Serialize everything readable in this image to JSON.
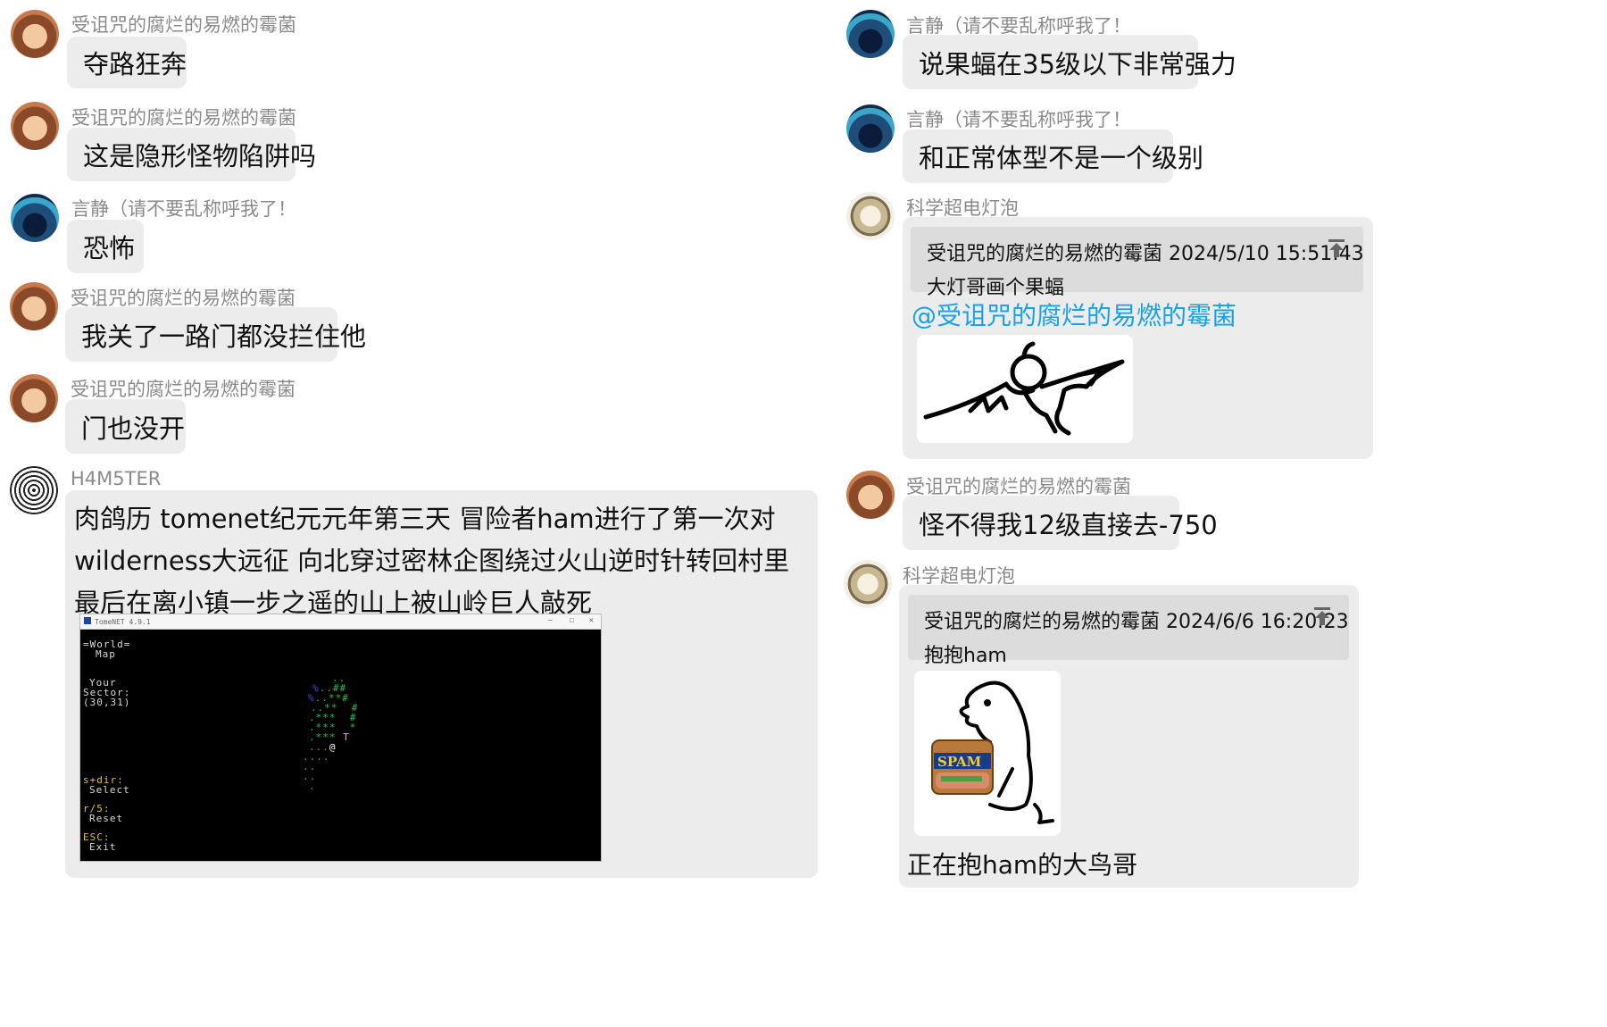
{
  "left": {
    "messages": [
      {
        "sender": "受诅咒的腐烂的易燃的霉菌",
        "text": "夺路狂奔"
      },
      {
        "sender": "受诅咒的腐烂的易燃的霉菌",
        "text": "这是隐形怪物陷阱吗"
      },
      {
        "sender": "言静（请不要乱称呼我了！",
        "text": "恐怖"
      },
      {
        "sender": "受诅咒的腐烂的易燃的霉菌",
        "text": "我关了一路门都没拦住他"
      },
      {
        "sender": "受诅咒的腐烂的易燃的霉菌",
        "text": "门也没开"
      }
    ],
    "ham": {
      "sender": "H4M5TER",
      "text": "肉鸽历 tomenet纪元元年第三天 冒险者ham进行了第一次对wilderness大远征 向北穿过密林企图绕过火山逆时针转回村里 最后在离小镇一步之遥的山上被山岭巨人敲死",
      "screenshot": {
        "window_title": "TomeNET 4.9.1",
        "world_title": "=World=",
        "map_label": "Map",
        "your": "Your",
        "sector": "Sector:",
        "coords": "(30,31)",
        "sdir_key": "s+dir:",
        "select": "Select",
        "r5_key": "r/5:",
        "reset": "Reset",
        "esc_key": "ESC:",
        "exit": "Exit"
      }
    }
  },
  "right": {
    "messages": [
      {
        "sender": "言静（请不要乱称呼我了！",
        "text": "说果蝠在35级以下非常强力"
      },
      {
        "sender": "言静（请不要乱称呼我了！",
        "text": "和正常体型不是一个级别"
      }
    ],
    "reply1": {
      "sender": "科学超电灯泡",
      "quote_head": "受诅咒的腐烂的易燃的霉菌  2024/5/10 15:51:43",
      "quote_text": "大灯哥画个果蝠",
      "mention": "@受诅咒的腐烂的易燃的霉菌"
    },
    "msg3": {
      "sender": "受诅咒的腐烂的易燃的霉菌",
      "text": "怪不得我12级直接去-750"
    },
    "reply2": {
      "sender": "科学超电灯泡",
      "quote_head": "受诅咒的腐烂的易燃的霉菌  2024/6/6 16:20:23",
      "quote_text": "抱抱ham",
      "caption": "正在抱ham的大鸟哥",
      "can_label": "SPAM"
    }
  },
  "colors": {
    "bubble": "#ececec",
    "quote": "#dcdcdc",
    "mention": "#1aa0e6",
    "sender": "#8a8a8a"
  }
}
